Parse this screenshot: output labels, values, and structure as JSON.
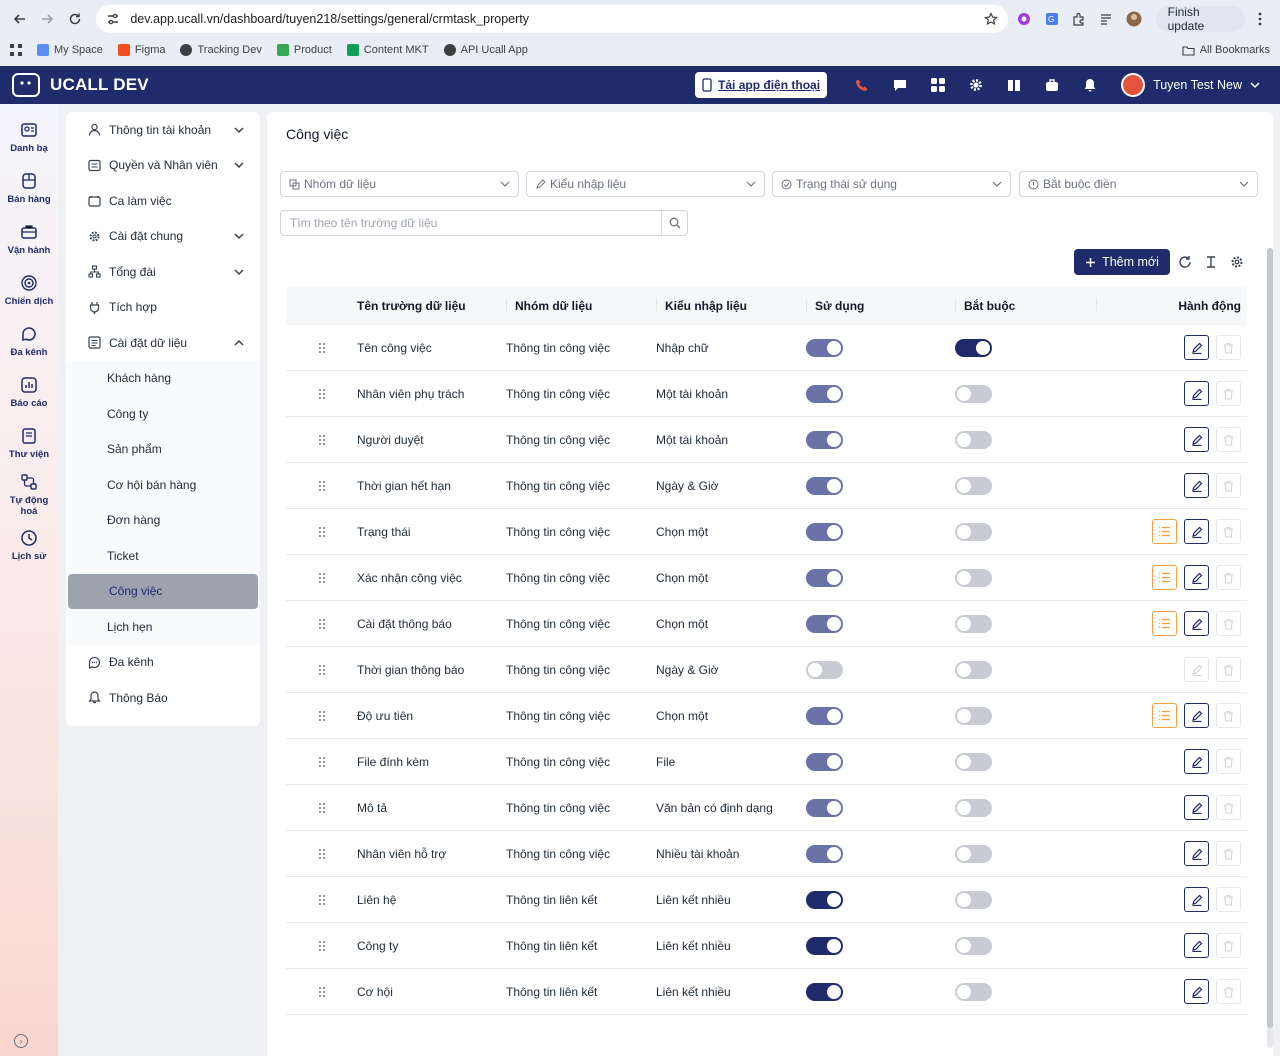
{
  "browser": {
    "url": "dev.app.ucall.vn/dashboard/tuyen218/settings/general/crmtask_property",
    "finish_update": "Finish update",
    "bookmarks": [
      "My Space",
      "Figma",
      "Tracking Dev",
      "Product",
      "Content MKT",
      "API Ucall App"
    ],
    "all_bookmarks": "All Bookmarks"
  },
  "app": {
    "brand": "UCALL DEV",
    "download_app": "Tải app điện thoại",
    "user_name": "Tuyen Test New",
    "accent": "#1f2b6b"
  },
  "rail": [
    {
      "label": "Danh bạ",
      "icon": "contacts-icon"
    },
    {
      "label": "Bán hàng",
      "icon": "sales-icon"
    },
    {
      "label": "Vận hành",
      "icon": "operations-icon"
    },
    {
      "label": "Chiến dịch",
      "icon": "campaign-icon"
    },
    {
      "label": "Đa kênh",
      "icon": "omnichannel-icon"
    },
    {
      "label": "Báo cáo",
      "icon": "report-icon"
    },
    {
      "label": "Thư viện",
      "icon": "library-icon"
    },
    {
      "label": "Tự động hoá",
      "icon": "automation-icon"
    },
    {
      "label": "Lịch sử",
      "icon": "history-icon"
    }
  ],
  "settings_menu": {
    "top": [
      {
        "label": "Thông tin tài khoản",
        "expand": true
      },
      {
        "label": "Quyền và Nhân viên",
        "expand": true
      },
      {
        "label": "Ca làm việc",
        "expand": false
      },
      {
        "label": "Cài đặt chung",
        "expand": true
      },
      {
        "label": "Tổng đài",
        "expand": true
      },
      {
        "label": "Tích hợp",
        "expand": false
      },
      {
        "label": "Cài đặt dữ liệu",
        "expand": true
      }
    ],
    "sub": [
      "Khách hàng",
      "Công ty",
      "Sản phẩm",
      "Cơ hội bán hàng",
      "Đơn hàng",
      "Ticket",
      "Công việc",
      "Lịch hẹn"
    ],
    "active_sub": "Công việc",
    "bottom": [
      "Đa kênh",
      "Thông Báo"
    ]
  },
  "page": {
    "title": "Công việc",
    "filters": [
      "Nhóm dữ liệu",
      "Kiểu nhập liệu",
      "Trạng thái sử dụng",
      "Bắt buộc điền"
    ],
    "search_placeholder": "Tìm theo tên trường dữ liệu",
    "add_button": "Thêm mới"
  },
  "table": {
    "headers": {
      "name": "Tên trường dữ liệu",
      "group": "Nhóm dữ liệu",
      "type": "Kiểu nhập liệu",
      "use": "Sử dụng",
      "required": "Bắt buộc",
      "actions": "Hành động"
    },
    "rows": [
      {
        "name": "Tên công việc",
        "group": "Thông tin công việc",
        "type": "Nhập chữ",
        "use": "on",
        "required": "on",
        "options": false,
        "edit": true
      },
      {
        "name": "Nhân viên phụ trách",
        "group": "Thông tin công việc",
        "type": "Một tài khoản",
        "use": "on",
        "required": "off",
        "options": false,
        "edit": true
      },
      {
        "name": "Người duyệt",
        "group": "Thông tin công việc",
        "type": "Một tài khoản",
        "use": "on",
        "required": "off",
        "options": false,
        "edit": true
      },
      {
        "name": "Thời gian hết hạn",
        "group": "Thông tin công việc",
        "type": "Ngày & Giờ",
        "use": "on",
        "required": "off",
        "options": false,
        "edit": true
      },
      {
        "name": "Trạng thái",
        "group": "Thông tin công việc",
        "type": "Chọn một",
        "use": "on",
        "required": "off",
        "options": true,
        "edit": true
      },
      {
        "name": "Xác nhận công việc",
        "group": "Thông tin công việc",
        "type": "Chọn một",
        "use": "on",
        "required": "off",
        "options": true,
        "edit": true
      },
      {
        "name": "Cài đặt thông báo",
        "group": "Thông tin công việc",
        "type": "Chọn một",
        "use": "on",
        "required": "off",
        "options": true,
        "edit": true
      },
      {
        "name": "Thời gian thông báo",
        "group": "Thông tin công việc",
        "type": "Ngày & Giờ",
        "use": "off",
        "required": "off",
        "options": false,
        "edit": false
      },
      {
        "name": "Độ ưu tiên",
        "group": "Thông tin công việc",
        "type": "Chọn một",
        "use": "on",
        "required": "off",
        "options": true,
        "edit": true
      },
      {
        "name": "File đính kèm",
        "group": "Thông tin công việc",
        "type": "File",
        "use": "on",
        "required": "off",
        "options": false,
        "edit": true
      },
      {
        "name": "Mô tả",
        "group": "Thông tin công việc",
        "type": "Văn bản có định dạng",
        "use": "on",
        "required": "off",
        "options": false,
        "edit": true
      },
      {
        "name": "Nhân viên hỗ trợ",
        "group": "Thông tin công việc",
        "type": "Nhiều tài khoản",
        "use": "on",
        "required": "off",
        "options": false,
        "edit": true
      },
      {
        "name": "Liên hệ",
        "group": "Thông tin liên kết",
        "type": "Liên kết nhiều",
        "use": "on-dark",
        "required": "off",
        "options": false,
        "edit": true
      },
      {
        "name": "Công ty",
        "group": "Thông tin liên kết",
        "type": "Liên kết nhiều",
        "use": "on-dark",
        "required": "off",
        "options": false,
        "edit": true
      },
      {
        "name": "Cơ hội",
        "group": "Thông tin liên kết",
        "type": "Liên kết nhiều",
        "use": "on-dark",
        "required": "off",
        "options": false,
        "edit": true
      }
    ]
  }
}
